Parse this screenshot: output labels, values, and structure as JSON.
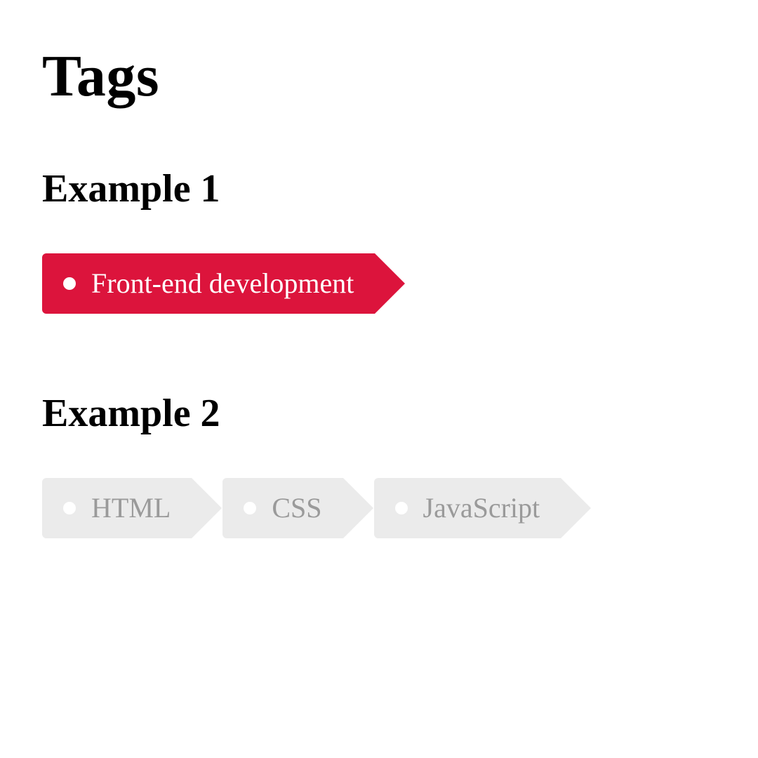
{
  "title": "Tags",
  "examples": [
    {
      "heading": "Example 1",
      "tags": [
        {
          "label": "Front-end development",
          "style": "red"
        }
      ]
    },
    {
      "heading": "Example 2",
      "tags": [
        {
          "label": "HTML",
          "style": "grey"
        },
        {
          "label": "CSS",
          "style": "grey"
        },
        {
          "label": "JavaScript",
          "style": "grey"
        }
      ]
    }
  ],
  "colors": {
    "accent": "#dc143c",
    "tag_bg": "#ebebeb",
    "tag_text": "#9a9a9a"
  }
}
